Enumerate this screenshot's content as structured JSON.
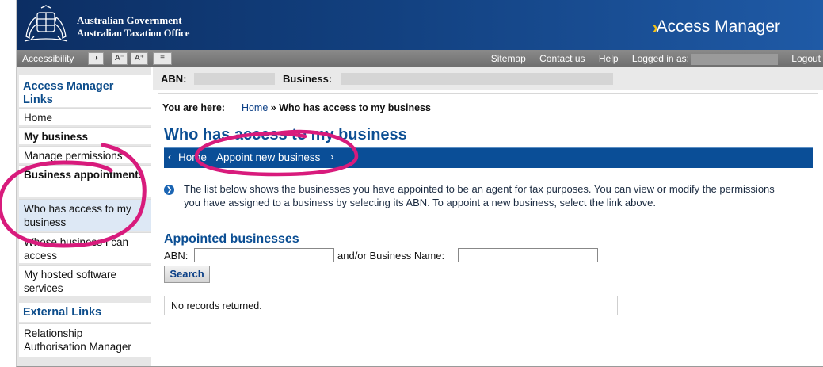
{
  "header": {
    "gov_line1": "Australian Government",
    "gov_line2": "Australian Taxation Office",
    "app_title": "Access Manager"
  },
  "toolbar": {
    "accessibility": "Accessibility",
    "contrast_icon": "◑",
    "font_decrease": "A⁻",
    "font_increase": "A⁺",
    "menu_icon": "≡",
    "sitemap": "Sitemap",
    "contact": "Contact us",
    "help": "Help",
    "logged_in": "Logged in as:",
    "logout": "Logout"
  },
  "sidebar": {
    "heading1": "Access Manager Links",
    "items": [
      {
        "label": "Home"
      },
      {
        "label": "My business"
      },
      {
        "label": "Manage permissions"
      },
      {
        "label": "Business appointments"
      },
      {
        "label": "Who has access to my business"
      },
      {
        "label": "Whose business I can access"
      },
      {
        "label": "My hosted software services"
      }
    ],
    "heading2": "External Links",
    "external": [
      {
        "label": "Relationship Authorisation Manager"
      }
    ]
  },
  "context": {
    "abn_label": "ABN:",
    "business_label": "Business:"
  },
  "breadcrumb": {
    "prefix": "You are here:",
    "home": "Home",
    "sep": "»",
    "current": "Who has access to my business"
  },
  "page": {
    "title": "Who has access to my business",
    "nav_home": "Home",
    "nav_appoint": "Appoint new business",
    "intro": "The list below shows the businesses you have appointed to be an agent for tax purposes. You can view or modify the permissions you have assigned to a business by selecting its ABN. To appoint a new business, select the link above.",
    "section_title": "Appointed businesses",
    "abn_field_label": "ABN:",
    "name_field_label": "and/or Business Name:",
    "search_button": "Search",
    "no_records": "No records returned."
  },
  "colors": {
    "brand_blue": "#0a4e97",
    "annotation_pink": "#d81b7c",
    "header_navy": "#0c2e63"
  }
}
